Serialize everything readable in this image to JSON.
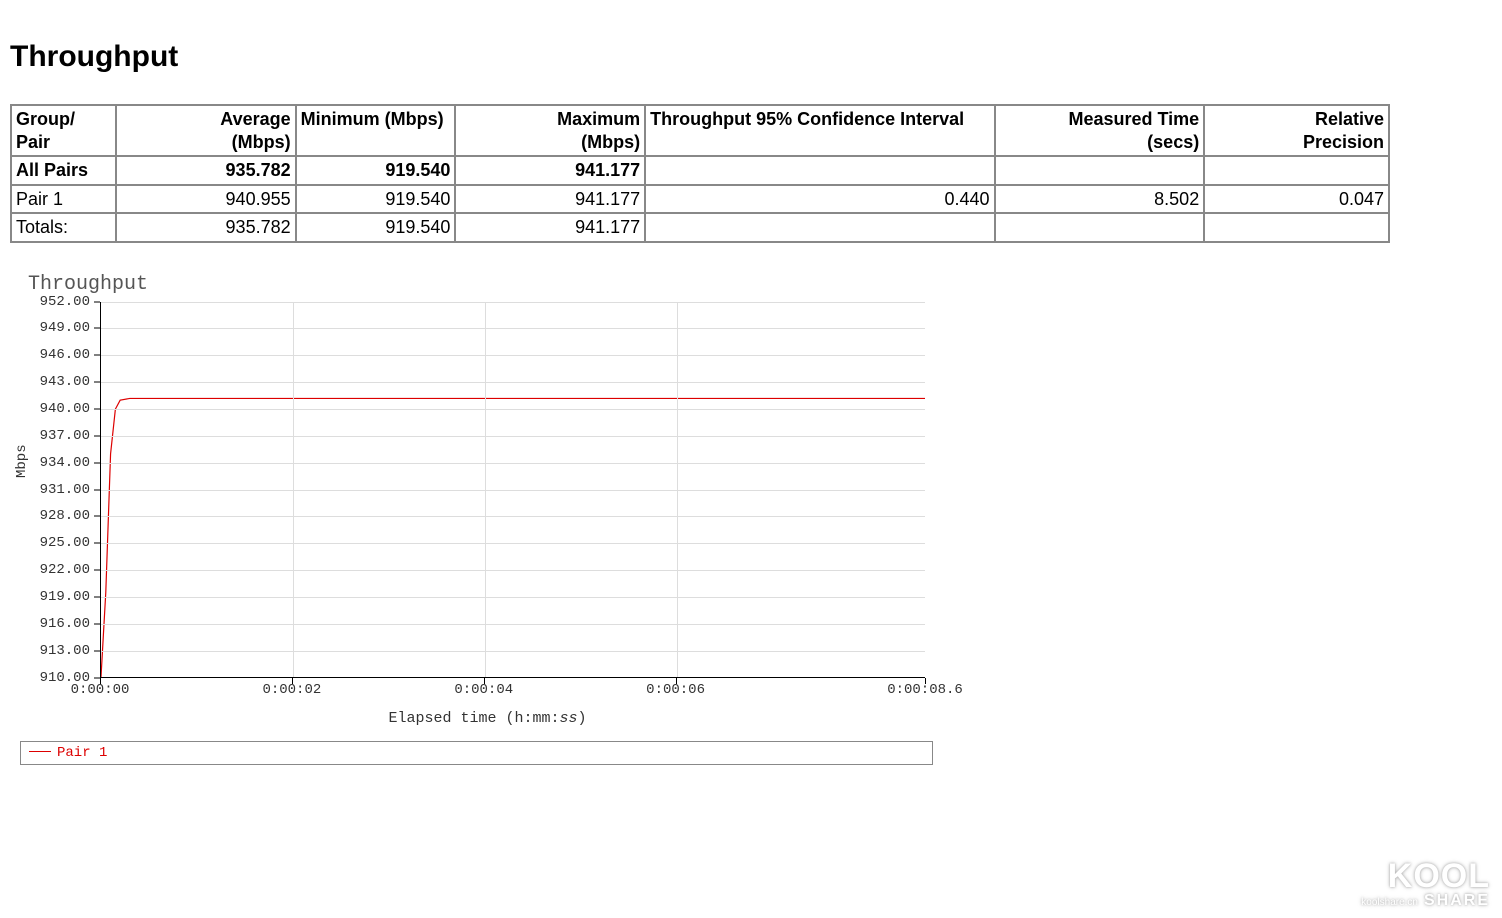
{
  "title": "Throughput",
  "table": {
    "headers": {
      "group_pair": "Group/\nPair",
      "avg": "Average\n(Mbps)",
      "min": "Minimum (Mbps)",
      "max": "Maximum\n(Mbps)",
      "ci": "Throughput 95% Confidence Interval",
      "time": "Measured Time\n(secs)",
      "prec": "Relative\nPrecision"
    },
    "rows": [
      {
        "label": "All Pairs",
        "bold": true,
        "avg": "935.782",
        "min": "919.540",
        "max": "941.177",
        "ci": "",
        "time": "",
        "prec": ""
      },
      {
        "label": "Pair 1",
        "bold": false,
        "avg": "940.955",
        "min": "919.540",
        "max": "941.177",
        "ci": "0.440",
        "time": "8.502",
        "prec": "0.047"
      },
      {
        "label": "Totals:",
        "bold": false,
        "avg": "935.782",
        "min": "919.540",
        "max": "941.177",
        "ci": "",
        "time": "",
        "prec": ""
      }
    ]
  },
  "chart_data": {
    "type": "line",
    "title": "Throughput",
    "ylabel": "Mbps",
    "xlabel_prefix": "Elapsed time (h:mm:",
    "xlabel_italic": "ss",
    "xlabel_suffix": ")",
    "ylim": [
      910,
      952
    ],
    "yticks": [
      910.0,
      913.0,
      916.0,
      919.0,
      922.0,
      925.0,
      928.0,
      931.0,
      934.0,
      937.0,
      940.0,
      943.0,
      946.0,
      949.0,
      952.0
    ],
    "ytick_labels": [
      "910.00",
      "913.00",
      "916.00",
      "919.00",
      "922.00",
      "925.00",
      "928.00",
      "931.00",
      "934.00",
      "937.00",
      "940.00",
      "943.00",
      "946.00",
      "949.00",
      "952.00"
    ],
    "xlim": [
      0,
      8.6
    ],
    "xticks": [
      0,
      2,
      4,
      6,
      8.6
    ],
    "xtick_labels": [
      "0:00:00",
      "0:00:02",
      "0:00:04",
      "0:00:06",
      "0:00:08.6"
    ],
    "grid_v": [
      2,
      4,
      6
    ],
    "series": [
      {
        "name": "Pair 1",
        "color": "#d00",
        "x": [
          0.0,
          0.05,
          0.1,
          0.15,
          0.2,
          0.3,
          8.6
        ],
        "y": [
          910.0,
          919.5,
          935.0,
          940.0,
          941.0,
          941.2,
          941.2
        ]
      }
    ]
  },
  "legend": {
    "label": "Pair 1"
  },
  "watermark": {
    "line1": "KOOL",
    "line2_small": "koolshare.cn",
    "line2_big": "SHARE"
  }
}
